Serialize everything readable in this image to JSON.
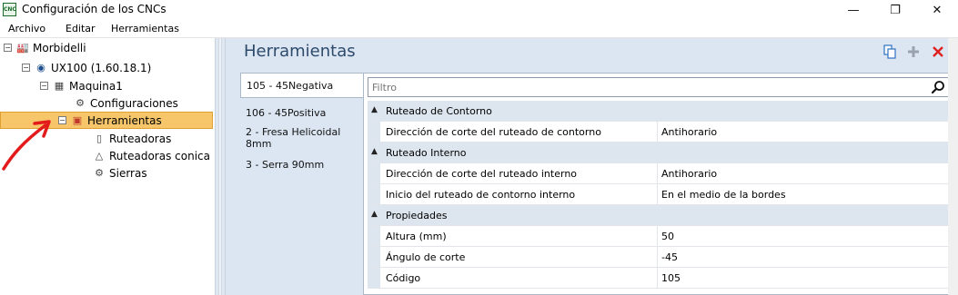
{
  "window": {
    "title": "Configuración de los CNCs",
    "app_icon": "CNC"
  },
  "menu": [
    "Archivo",
    "Editar",
    "Herramientas"
  ],
  "tree": {
    "nodes": [
      {
        "label": "Morbidelli",
        "icon": "factory-icon"
      },
      {
        "label": "UX100 (1.60.18.1)",
        "icon": "machine-globe-icon"
      },
      {
        "label": "Maquina1",
        "icon": "machine-icon"
      },
      {
        "label": "Configuraciones",
        "icon": "gear-icon"
      },
      {
        "label": "Herramientas",
        "icon": "toolbox-icon"
      },
      {
        "label": "Ruteadoras",
        "icon": "router-bit-icon"
      },
      {
        "label": "Ruteadoras conica",
        "icon": "conical-bit-icon"
      },
      {
        "label": "Sierras",
        "icon": "saw-blade-icon"
      }
    ]
  },
  "panel": {
    "title": "Herramientas",
    "tools": [
      "copy-icon",
      "add-icon",
      "delete-icon"
    ]
  },
  "tabs": [
    "105 - 45Negativa",
    "106 - 45Positiva",
    "2 - Fresa Helicoidal 8mm",
    "3 - Serra 90mm"
  ],
  "filter": {
    "placeholder": "Filtro"
  },
  "grid": {
    "sections": [
      {
        "label": "Ruteado de Contorno",
        "rows": [
          {
            "name": "Dirección de corte del ruteado de contorno",
            "value": "Antihorario"
          }
        ]
      },
      {
        "label": "Ruteado Interno",
        "rows": [
          {
            "name": "Dirección de corte del ruteado interno",
            "value": "Antihorario"
          },
          {
            "name": "Inicio del ruteado de contorno interno",
            "value": "En el medio de la bordes"
          }
        ]
      },
      {
        "label": "Propiedades",
        "rows": [
          {
            "name": "Altura (mm)",
            "value": "50"
          },
          {
            "name": "Ángulo de corte",
            "value": "-45"
          },
          {
            "name": "Código",
            "value": "105"
          }
        ]
      }
    ]
  },
  "colors": {
    "selection": "#f7c66b",
    "panel_bg": "#dbe6f2",
    "title_text": "#2e4a6b"
  }
}
